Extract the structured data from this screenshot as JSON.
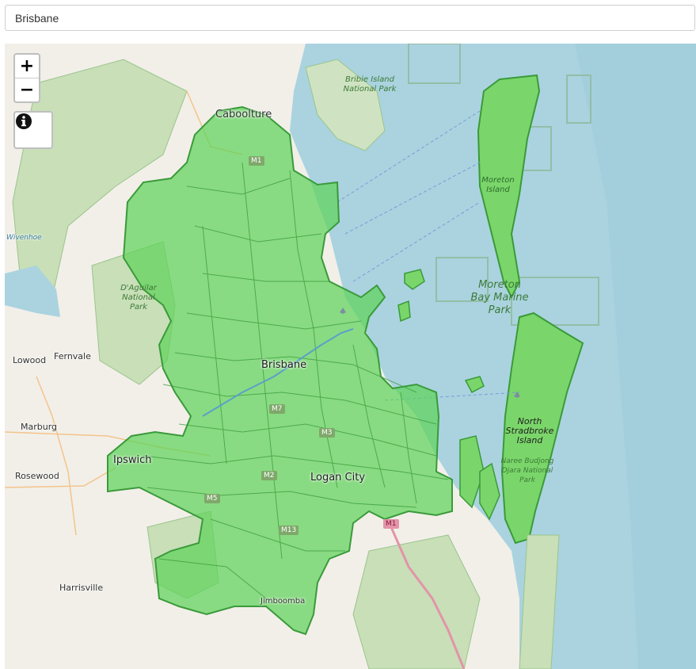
{
  "search": {
    "value": "Brisbane",
    "placeholder": ""
  },
  "controls": {
    "zoom_in": "+",
    "zoom_out": "−",
    "info_icon": "info-circle-icon"
  },
  "map": {
    "colors": {
      "water": "#aad3df",
      "land": "#f2efe9",
      "region_fill": "#5ed35a",
      "region_border": "#3a9a3a",
      "park": "#c8dfb8"
    },
    "places": {
      "caboolture": "Caboolture",
      "bribie": "Bribie Island National Park",
      "wivenhoe": "Wivenhoe",
      "daguilar": "D'Aguilar National Park",
      "moreton_island": "Moreton Island",
      "moreton_bay": "Moreton Bay Marine Park",
      "lowood": "Lowood",
      "fernvale": "Fernvale",
      "brisbane": "Brisbane",
      "marburg": "Marburg",
      "ipswich": "Ipswich",
      "rosewood": "Rosewood",
      "north_stradbroke": "North Stradbroke Island",
      "naree": "Naree Budjong Djara National Park",
      "logan": "Logan City",
      "harrisville": "Harrisville",
      "jimboomba": "Jimboomba"
    },
    "road_shields": {
      "m1_north": "M1",
      "m7": "M7",
      "m3": "M3",
      "m2": "M2",
      "m5": "M5",
      "m13": "M13",
      "m1_south": "M1"
    }
  }
}
